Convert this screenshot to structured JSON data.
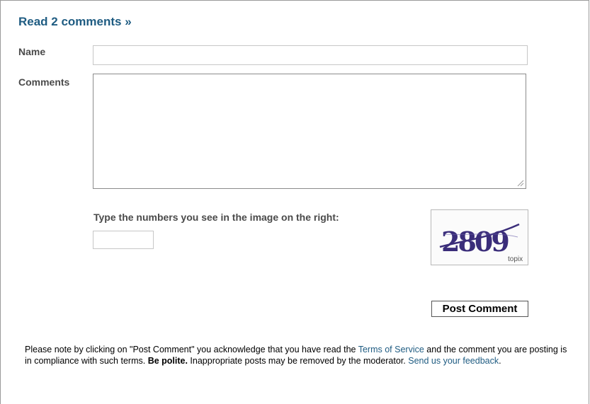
{
  "header": {
    "read_comments_link": "Read 2 comments »"
  },
  "form": {
    "name_label": "Name",
    "name_value": "",
    "comments_label": "Comments",
    "comments_value": "",
    "captcha_prompt": "Type the numbers you see in the image on the right:",
    "captcha_value": "",
    "captcha_image": {
      "digits": "2809",
      "brand": "topix"
    },
    "post_button": "Post Comment"
  },
  "notice": {
    "part1": "Please note by clicking on \"Post Comment\" you acknowledge that you have read the ",
    "tos_link": "Terms of Service",
    "part2": " and the comment you are posting is in compliance with such terms. ",
    "be_polite": "Be polite.",
    "part3": " Inappropriate posts may be removed by the moderator. ",
    "feedback_link": "Send us your feedback",
    "part4": "."
  },
  "colors": {
    "link": "#1f5c82",
    "label": "#4a4a4a",
    "captcha_text": "#3a2d7a"
  }
}
